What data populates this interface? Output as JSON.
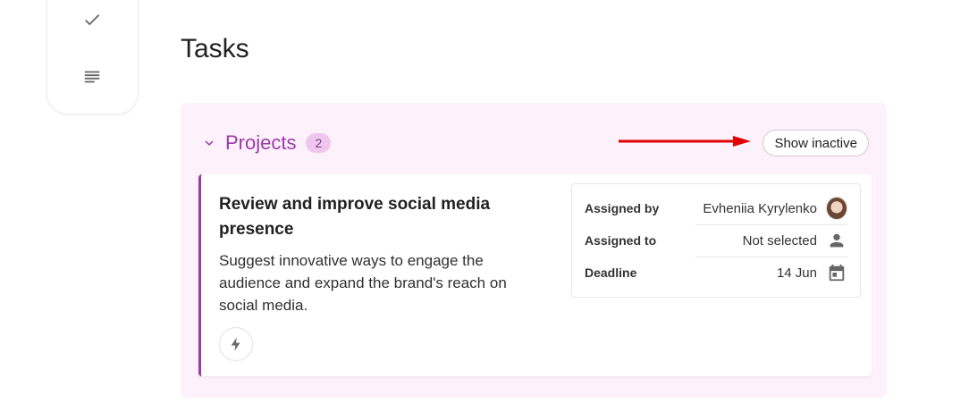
{
  "page": {
    "title": "Tasks"
  },
  "rail": {
    "icons": [
      "check-icon",
      "notes-icon"
    ]
  },
  "projects": {
    "title": "Projects",
    "count": "2",
    "show_inactive_label": "Show inactive",
    "accent_color": "#9c3aa9",
    "background_color": "#fdf1fc"
  },
  "task": {
    "title": "Review and improve social media presence",
    "description": "Suggest innovative ways to engage the audience and expand the brand's reach on social media.",
    "action_icon": "bolt-icon",
    "details": [
      {
        "label": "Assigned by",
        "value": "Evheniia Kyrylenko",
        "icon": "avatar"
      },
      {
        "label": "Assigned to",
        "value": "Not selected",
        "icon": "person-icon"
      },
      {
        "label": "Deadline",
        "value": "14 Jun",
        "icon": "calendar-icon"
      }
    ]
  },
  "annotation": {
    "arrow_color": "#e00000"
  }
}
